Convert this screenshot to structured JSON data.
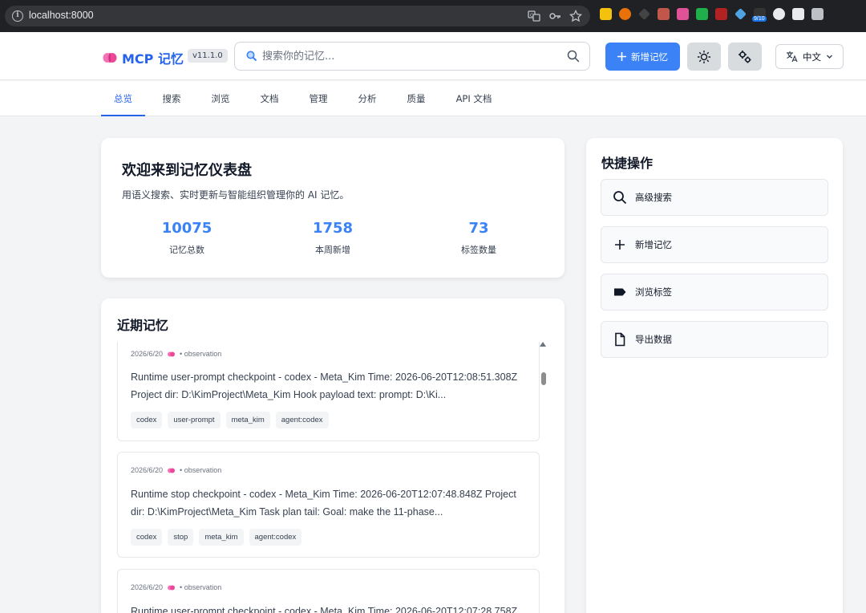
{
  "browser": {
    "url": "localhost:8000",
    "ext_badge": "9/10"
  },
  "header": {
    "logo_text": "MCP 记忆",
    "version": "v11.1.0",
    "search_placeholder": "搜索你的记忆...",
    "new_button": "新增记忆",
    "lang_label": "中文"
  },
  "tabs": [
    {
      "label": "总览",
      "active": true
    },
    {
      "label": "搜索"
    },
    {
      "label": "浏览"
    },
    {
      "label": "文档"
    },
    {
      "label": "管理"
    },
    {
      "label": "分析"
    },
    {
      "label": "质量"
    },
    {
      "label": "API 文档"
    }
  ],
  "welcome": {
    "title": "欢迎来到记忆仪表盘",
    "subtitle": "用语义搜索、实时更新与智能组织管理你的 AI 记忆。",
    "stats": [
      {
        "value": "10075",
        "label": "记忆总数"
      },
      {
        "value": "1758",
        "label": "本周新增"
      },
      {
        "value": "73",
        "label": "标签数量"
      }
    ]
  },
  "recent": {
    "title": "近期记忆",
    "items": [
      {
        "date": "2026/6/20",
        "type": "• observation",
        "text": "Runtime user-prompt checkpoint - codex - Meta_Kim Time: 2026-06-20T12:08:51.308Z Project dir: D:\\KimProject\\Meta_Kim Hook payload text: prompt: D:\\Ki...",
        "tags": [
          "codex",
          "user-prompt",
          "meta_kim",
          "agent:codex"
        ]
      },
      {
        "date": "2026/6/20",
        "type": "• observation",
        "text": "Runtime stop checkpoint - codex - Meta_Kim Time: 2026-06-20T12:07:48.848Z Project dir: D:\\KimProject\\Meta_Kim Task plan tail: Goal: make the 11-phase...",
        "tags": [
          "codex",
          "stop",
          "meta_kim",
          "agent:codex"
        ]
      },
      {
        "date": "2026/6/20",
        "type": "• observation",
        "text": "Runtime user-prompt checkpoint - codex - Meta_Kim Time: 2026-06-20T12:07:28.758Z",
        "tags": []
      }
    ]
  },
  "quick": {
    "title": "快捷操作",
    "actions": [
      {
        "label": "高级搜索",
        "icon": "search-icon"
      },
      {
        "label": "新增记忆",
        "icon": "plus-icon"
      },
      {
        "label": "浏览标签",
        "icon": "tag-icon"
      },
      {
        "label": "导出数据",
        "icon": "file-icon"
      }
    ]
  },
  "colors": {
    "accent": "#3b82f6",
    "brand": "#2563eb"
  }
}
